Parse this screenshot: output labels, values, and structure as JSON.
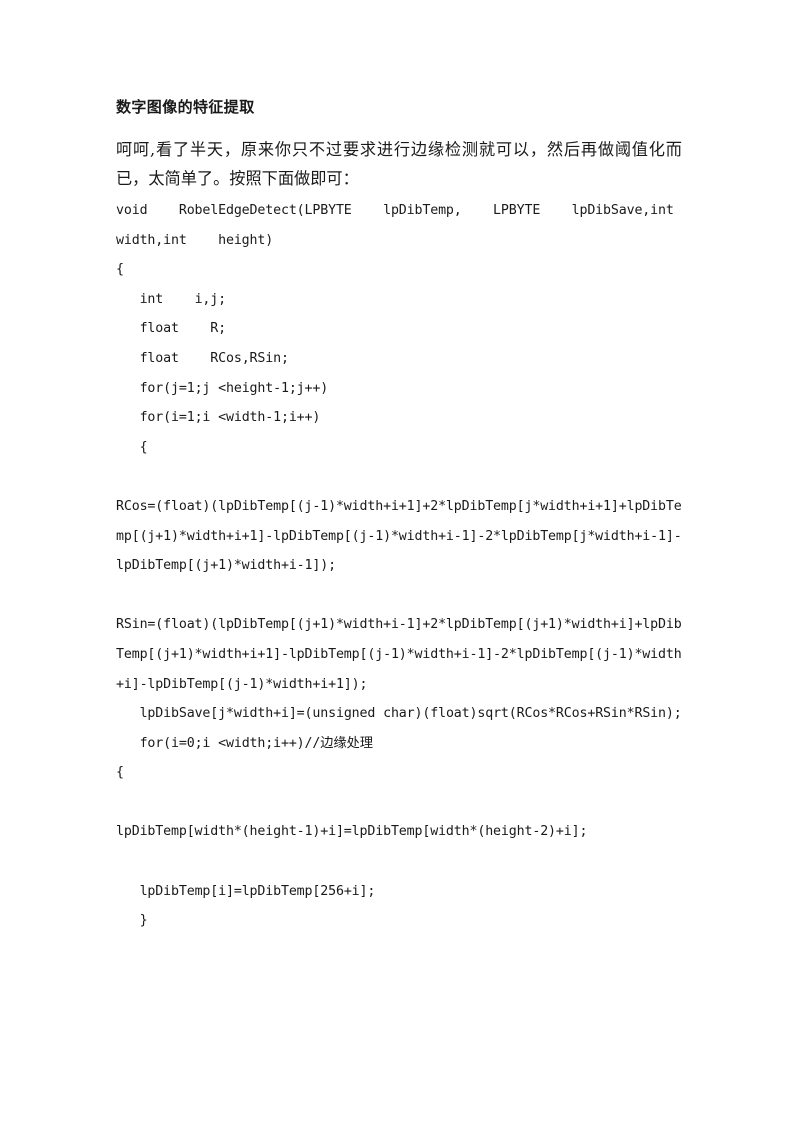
{
  "document": {
    "title": "数字图像的特征提取",
    "intro_paragraph": "呵呵,看了半天，原来你只不过要求进行边缘检测就可以，然后再做阈值化而已，太简单了。按照下面做即可：",
    "code_lines": [
      "void    RobelEdgeDetect(LPBYTE    lpDibTemp,    LPBYTE    lpDibSave,int    width,int    height)",
      "{",
      "   int    i,j;",
      "   float    R;",
      "   float    RCos,RSin;",
      "   for(j=1;j <height-1;j++)",
      "   for(i=1;i <width-1;i++)",
      "   {",
      "",
      "RCos=(float)(lpDibTemp[(j-1)*width+i+1]+2*lpDibTemp[j*width+i+1]+lpDibTemp[(j+1)*width+i+1]-lpDibTemp[(j-1)*width+i-1]-2*lpDibTemp[j*width+i-1]-lpDibTemp[(j+1)*width+i-1]);",
      "",
      "RSin=(float)(lpDibTemp[(j+1)*width+i-1]+2*lpDibTemp[(j+1)*width+i]+lpDibTemp[(j+1)*width+i+1]-lpDibTemp[(j-1)*width+i-1]-2*lpDibTemp[(j-1)*width+i]-lpDibTemp[(j-1)*width+i+1]);",
      "   lpDibSave[j*width+i]=(unsigned char)(float)sqrt(RCos*RCos+RSin*RSin);",
      "   for(i=0;i <width;i++)//边缘处理",
      "{",
      "",
      "lpDibTemp[width*(height-1)+i]=lpDibTemp[width*(height-2)+i];",
      "",
      "   lpDibTemp[i]=lpDibTemp[256+i];",
      "   }"
    ]
  }
}
